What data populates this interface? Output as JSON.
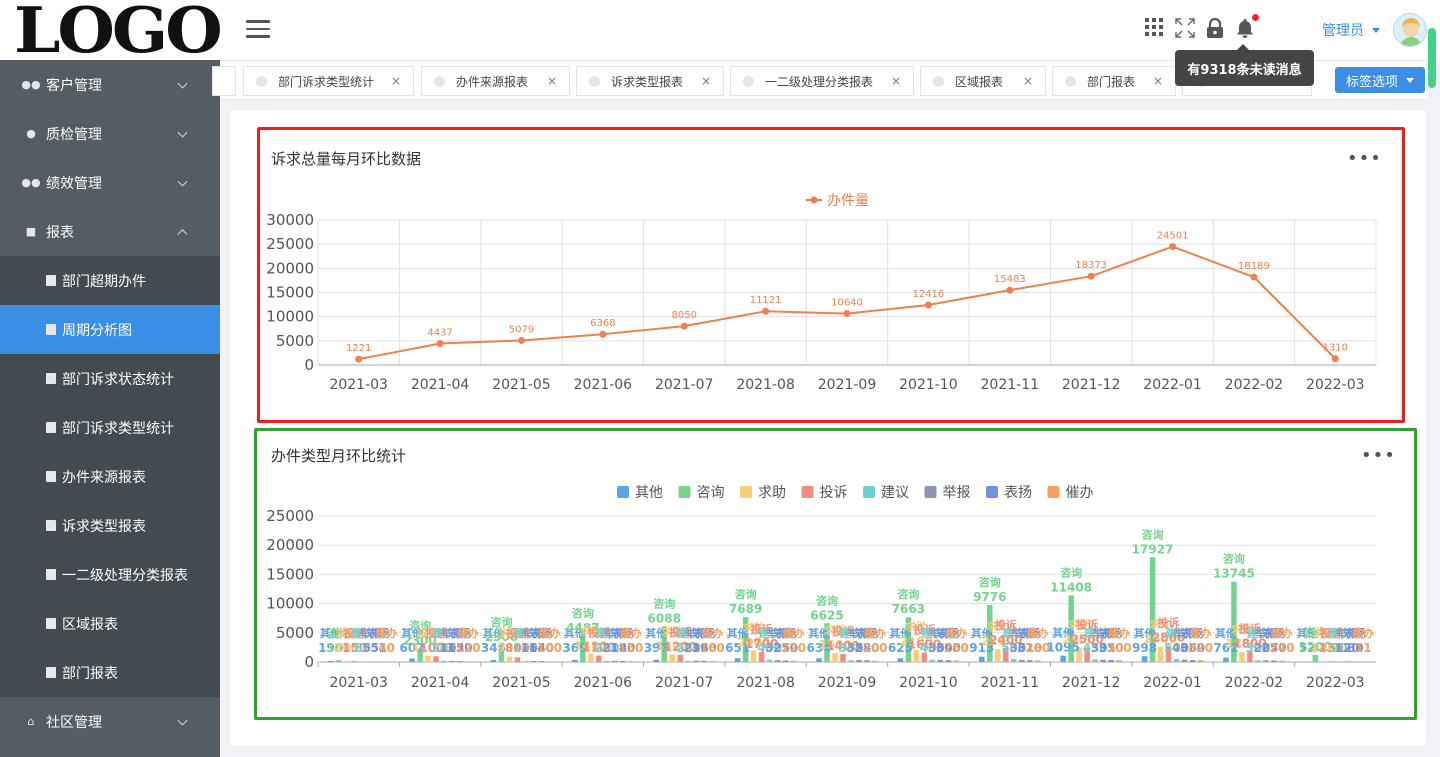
{
  "logo": "LOGO",
  "sidebar": {
    "items": [
      {
        "label": "客户管理",
        "icon": "users-icon"
      },
      {
        "label": "质检管理",
        "icon": "info-icon"
      },
      {
        "label": "绩效管理",
        "icon": "users-icon"
      },
      {
        "label": "报表",
        "icon": "folder-icon"
      }
    ],
    "sub_items": [
      "部门超期办件",
      "周期分析图",
      "部门诉求状态统计",
      "部门诉求类型统计",
      "办件来源报表",
      "诉求类型报表",
      "一二级处理分类报表",
      "区域报表",
      "部门报表"
    ],
    "active_sub": "周期分析图",
    "bottom_item": {
      "label": "社区管理",
      "icon": "home-icon"
    }
  },
  "header": {
    "user": "管理员",
    "tooltip": "有9318条未读消息"
  },
  "tabs": [
    "部门诉求类型统计",
    "办件来源报表",
    "诉求类型报表",
    "一二级处理分类报表",
    "区域报表",
    "部门报表"
  ],
  "tab_close": "×",
  "tab_options_label": "标签选项",
  "more_label": "•••",
  "chart_data": [
    {
      "type": "line",
      "title": "诉求总量每月环比数据",
      "legend": [
        "办件量"
      ],
      "color": "#f0804f",
      "categories": [
        "2021-03",
        "2021-04",
        "2021-05",
        "2021-06",
        "2021-07",
        "2021-08",
        "2021-09",
        "2021-10",
        "2021-11",
        "2021-12",
        "2022-01",
        "2022-02",
        "2022-03"
      ],
      "series": [
        {
          "name": "办件量",
          "values": [
            1221,
            4437,
            5079,
            6368,
            8050,
            11121,
            10640,
            12416,
            15483,
            18373,
            24501,
            18189,
            1310
          ]
        }
      ],
      "ylim": [
        0,
        30000
      ],
      "yticks": [
        0,
        5000,
        10000,
        15000,
        20000,
        25000,
        30000
      ],
      "grid": true
    },
    {
      "type": "bar",
      "title": "办件类型月环比统计",
      "categories": [
        "2021-03",
        "2021-04",
        "2021-05",
        "2021-06",
        "2021-07",
        "2021-08",
        "2021-09",
        "2021-10",
        "2021-11",
        "2021-12",
        "2022-01",
        "2022-02",
        "2022-03"
      ],
      "series": [
        {
          "name": "其他",
          "color": "#5aa4e8",
          "values": [
            190,
            607,
            345,
            369,
            397,
            651,
            634,
            625,
            913,
            1095,
            998,
            762,
            52
          ]
        },
        {
          "name": "咨询",
          "color": "#73d48e",
          "values": [
            300,
            2300,
            2900,
            4487,
            6088,
            7689,
            6625,
            7663,
            9776,
            11408,
            17927,
            13745,
            1200
          ]
        },
        {
          "name": "求助",
          "color": "#f5cf77",
          "values": [
            200,
            1100,
            900,
            1400,
            1300,
            2000,
            1500,
            2100,
            2200,
            2500,
            2600,
            1700,
            150
          ]
        },
        {
          "name": "投诉",
          "color": "#f08d7e",
          "values": [
            150,
            1000,
            800,
            1100,
            1200,
            1700,
            1400,
            1600,
            2400,
            2500,
            2800,
            1800,
            130
          ]
        },
        {
          "name": "建议",
          "color": "#70cfd0",
          "values": [
            60,
            200,
            150,
            200,
            200,
            400,
            300,
            400,
            500,
            450,
            500,
            300,
            20
          ]
        },
        {
          "name": "举报",
          "color": "#8e93b4",
          "values": [
            55,
            162,
            164,
            212,
            236,
            325,
            352,
            364,
            361,
            391,
            406,
            287,
            120
          ]
        },
        {
          "name": "表扬",
          "color": "#6e93e0",
          "values": [
            51,
            150,
            140,
            180,
            190,
            250,
            280,
            300,
            310,
            350,
            330,
            250,
            80
          ]
        },
        {
          "name": "催办",
          "color": "#f4a35e",
          "values": [
            40,
            120,
            100,
            150,
            160,
            220,
            200,
            250,
            280,
            300,
            320,
            240,
            11
          ]
        }
      ],
      "ylim": [
        0,
        25000
      ],
      "yticks": [
        0,
        5000,
        10000,
        15000,
        20000,
        25000
      ],
      "grid": true
    }
  ]
}
